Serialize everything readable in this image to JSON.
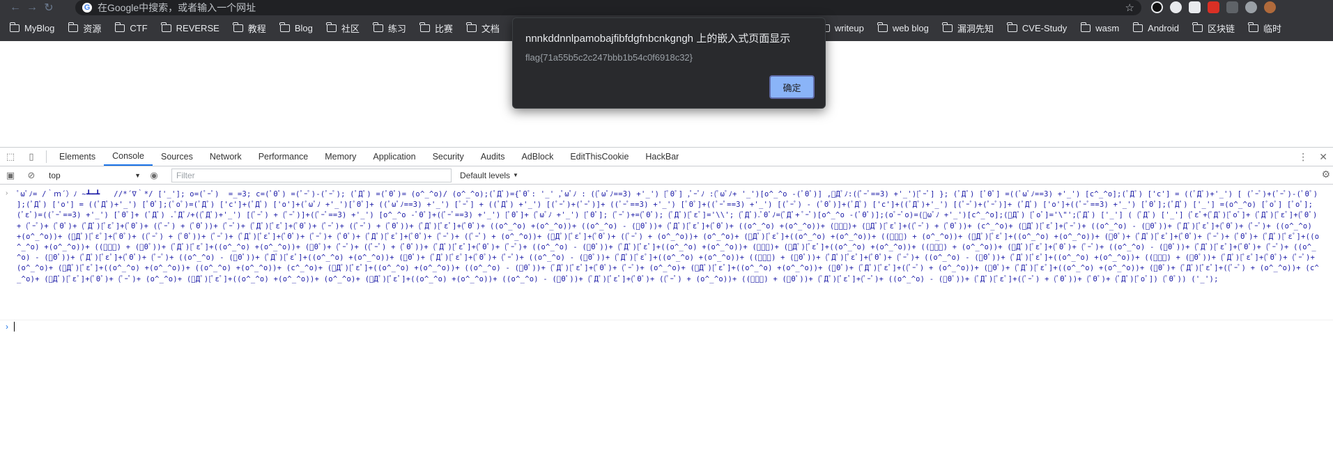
{
  "browser": {
    "omnibox_placeholder": "在Google中搜索，或者输入一个网址",
    "ext_colors": [
      "#111111",
      "#e8eaed",
      "#c5221f",
      "#d93025",
      "#5f6368",
      "#9aa0a6",
      "#b06a3b"
    ]
  },
  "bookmarks": [
    "MyBlog",
    "资源",
    "CTF",
    "REVERSE",
    "教程",
    "Blog",
    "社区",
    "练习",
    "比赛",
    "文档",
    "writeup",
    "web blog",
    "漏洞先知",
    "CVE-Study",
    "wasm",
    "Android",
    "区块链",
    "临时"
  ],
  "dialog": {
    "title": "nnnkddnnlpamobajfibfdgfnbcnkgngh 上的嵌入式页面显示",
    "message": "flag{71a55b5c2c247bbb1b54c0f6918c32}",
    "ok_label": "确定"
  },
  "devtools": {
    "tabs": [
      "Elements",
      "Console",
      "Sources",
      "Network",
      "Performance",
      "Memory",
      "Application",
      "Security",
      "Audits",
      "AdBlock",
      "EditThisCookie",
      "HackBar"
    ],
    "active_tab": "Console",
    "context": "top",
    "filter_placeholder": "Filter",
    "levels_label": "Default levels"
  },
  "console": {
    "entry_text": "ﾟωﾟﾉ= /｀ｍ´）ﾉ ~┻━┻   //*´∇｀*/ ['_']; o=(ﾟｰﾟ)  =_=3; c=(ﾟΘﾟ) =(ﾟｰﾟ)-(ﾟｰﾟ); (ﾟДﾟ) =(ﾟΘﾟ)= (o^_^o)/ (o^_^o);(ﾟДﾟ)={ﾟΘﾟ: '_' ,ﾟωﾟﾉ : ((ﾟωﾟﾉ==3) +'_') [ﾟΘﾟ] ,ﾟｰﾟﾉ :(ﾟωﾟﾉ+ '_')[o^_^o -(ﾟΘﾟ)] ,ﾟДﾟﾉ:((ﾟｰﾟ==3) +'_')[ﾟｰﾟ] }; (ﾟДﾟ) [ﾟΘﾟ] =((ﾟωﾟﾉ==3) +'_') [c^_^o];(ﾟДﾟ) ['c'] = ((ﾟДﾟ)+'_') [ (ﾟｰﾟ)+(ﾟｰﾟ)-(ﾟΘﾟ) ];(ﾟДﾟ) ['o'] = ((ﾟДﾟ)+'_') [ﾟΘﾟ];(ﾟoﾟ)=(ﾟДﾟ) ['c']+(ﾟДﾟ) ['o']+(ﾟωﾟﾉ +'_')[ﾟΘﾟ]+ ((ﾟωﾟﾉ==3) +'_') [ﾟｰﾟ] + ((ﾟДﾟ) +'_') [(ﾟｰﾟ)+(ﾟｰﾟ)]+ ((ﾟｰﾟ==3) +'_') [ﾟΘﾟ]+((ﾟｰﾟ==3) +'_') [(ﾟｰﾟ) - (ﾟΘﾟ)]+(ﾟДﾟ) ['c']+((ﾟДﾟ)+'_') [(ﾟｰﾟ)+(ﾟｰﾟ)]+ (ﾟДﾟ) ['o']+((ﾟｰﾟ==3) +'_') [ﾟΘﾟ];(ﾟДﾟ) ['_'] =(o^_^o) [ﾟoﾟ] [ﾟoﾟ];(ﾟεﾟ)=((ﾟｰﾟ==3) +'_') [ﾟΘﾟ]+ (ﾟДﾟ) .ﾟДﾟﾉ+((ﾟДﾟ)+'_') [(ﾟｰﾟ) + (ﾟｰﾟ)]+((ﾟｰﾟ==3) +'_') [o^_^o -ﾟΘﾟ]+((ﾟｰﾟ==3) +'_') [ﾟΘﾟ]+ (ﾟωﾟﾉ +'_') [ﾟΘﾟ]; (ﾟｰﾟ)+=(ﾟΘﾟ); (ﾟДﾟ)[ﾟεﾟ]='\\\\'; (ﾟДﾟ).ﾟΘﾟﾉ=(ﾟДﾟ+ ﾟｰﾟ)[o^_^o -(ﾟΘﾟ)];(oﾟｰﾟo)=(ﾟωﾟﾉ +'_')[c^_^o];(ﾟДﾟ) [ﾟoﾟ]='\\\"';(ﾟДﾟ) ['_'] ( (ﾟДﾟ) ['_'] (ﾟεﾟ+(ﾟДﾟ)[ﾟoﾟ]+ (ﾟДﾟ)[ﾟεﾟ]+(ﾟΘﾟ)+ (ﾟｰﾟ)+ (ﾟΘﾟ)+ (ﾟДﾟ)[ﾟεﾟ]+(ﾟΘﾟ)+ ((ﾟｰﾟ) + (ﾟΘﾟ))+ (ﾟｰﾟ)+ (ﾟДﾟ)[ﾟεﾟ]+(ﾟΘﾟ)+ (ﾟｰﾟ)+ ((ﾟｰﾟ) + (ﾟΘﾟ))+ (ﾟДﾟ)[ﾟεﾟ]+(ﾟΘﾟ)+ ((o^_^o) +(o^_^o))+ ((o^_^o) - (ﾟΘﾟ))+ (ﾟДﾟ)[ﾟεﾟ]+(ﾟΘﾟ)+ ((o^_^o) +(o^_^o))+ (ﾟｰﾟ)+ (ﾟДﾟ)[ﾟεﾟ]+((ﾟｰﾟ) + (ﾟΘﾟ))+ (c^_^o)+ (ﾟДﾟ)[ﾟεﾟ]+(ﾟｰﾟ)+ ((o^_^o) - (ﾟΘﾟ))+ (ﾟДﾟ)[ﾟεﾟ]+(ﾟΘﾟ)+ (ﾟｰﾟ)+ ((o^_^o) +(o^_^o))+ (ﾟДﾟ)[ﾟεﾟ]+(ﾟΘﾟ)+ ((ﾟｰﾟ) + (ﾟΘﾟ))+ (ﾟｰﾟ)+ (ﾟДﾟ)[ﾟεﾟ]+(ﾟΘﾟ)+ (ﾟｰﾟ)+ (ﾟΘﾟ)+ (ﾟДﾟ)[ﾟεﾟ]+(ﾟΘﾟ)+ (ﾟｰﾟ)+ ((ﾟｰﾟ) + (o^_^o))+ (ﾟДﾟ)[ﾟεﾟ]+(ﾟΘﾟ)+ ((ﾟｰﾟ) + (o^_^o))+ (o^_^o)+ (ﾟДﾟ)[ﾟεﾟ]+((o^_^o) +(o^_^o))+ ((ﾟｰﾟ) + (o^_^o))+ (ﾟДﾟ)[ﾟεﾟ]+((o^_^o) +(o^_^o))+ (ﾟΘﾟ)+ (ﾟДﾟ)[ﾟεﾟ]+(ﾟΘﾟ)+ (ﾟｰﾟ)+ (ﾟΘﾟ)+ (ﾟДﾟ)[ﾟεﾟ]+((o^_^o) +(o^_^o))+ ((ﾟｰﾟ) + (ﾟΘﾟ))+ (ﾟДﾟ)[ﾟεﾟ]+((o^_^o) +(o^_^o))+ (ﾟΘﾟ)+ (ﾟｰﾟ)+ ((ﾟｰﾟ) + (ﾟΘﾟ))+ (ﾟДﾟ)[ﾟεﾟ]+(ﾟΘﾟ)+ (ﾟｰﾟ)+ ((o^_^o) - (ﾟΘﾟ))+ (ﾟДﾟ)[ﾟεﾟ]+((o^_^o) +(o^_^o))+ (ﾟｰﾟ)+ (ﾟДﾟ)[ﾟεﾟ]+((o^_^o) +(o^_^o))+ ((ﾟｰﾟ) + (o^_^o))+ (ﾟДﾟ)[ﾟεﾟ]+(ﾟΘﾟ)+ (ﾟｰﾟ)+ ((o^_^o) - (ﾟΘﾟ))+ (ﾟДﾟ)[ﾟεﾟ]+(ﾟΘﾟ)+ (ﾟｰﾟ)+ ((o^_^o) - (ﾟΘﾟ))+ (ﾟДﾟ)[ﾟεﾟ]+(ﾟΘﾟ)+ (ﾟｰﾟ)+ ((o^_^o) - (ﾟΘﾟ))+ (ﾟДﾟ)[ﾟεﾟ]+((o^_^o) +(o^_^o))+ (ﾟΘﾟ)+ (ﾟДﾟ)[ﾟεﾟ]+(ﾟΘﾟ)+ (ﾟｰﾟ)+ ((o^_^o) - (ﾟΘﾟ))+ (ﾟДﾟ)[ﾟεﾟ]+((o^_^o) +(o^_^o))+ ((ﾟｰﾟ) + (ﾟΘﾟ))+ (ﾟДﾟ)[ﾟεﾟ]+(ﾟΘﾟ)+ (ﾟｰﾟ)+ ((o^_^o) - (ﾟΘﾟ))+ (ﾟДﾟ)[ﾟεﾟ]+((o^_^o) +(o^_^o))+ ((ﾟｰﾟ) + (ﾟΘﾟ))+ (ﾟДﾟ)[ﾟεﾟ]+(ﾟΘﾟ)+ (ﾟｰﾟ)+ (o^_^o)+ (ﾟДﾟ)[ﾟεﾟ]+((o^_^o) +(o^_^o))+ ((o^_^o) +(o^_^o))+ (c^_^o)+ (ﾟДﾟ)[ﾟεﾟ]+((o^_^o) +(o^_^o))+ ((o^_^o) - (ﾟΘﾟ))+ (ﾟДﾟ)[ﾟεﾟ]+(ﾟΘﾟ)+ (ﾟｰﾟ)+ (o^_^o)+ (ﾟДﾟ)[ﾟεﾟ]+((o^_^o) +(o^_^o))+ (ﾟΘﾟ)+ (ﾟДﾟ)[ﾟεﾟ]+((ﾟｰﾟ) + (o^_^o))+ (ﾟΘﾟ)+ (ﾟДﾟ)[ﾟεﾟ]+((o^_^o) +(o^_^o))+ (ﾟΘﾟ)+ (ﾟДﾟ)[ﾟεﾟ]+((ﾟｰﾟ) + (o^_^o))+ (c^_^o)+ (ﾟДﾟ)[ﾟεﾟ]+(ﾟΘﾟ)+ (ﾟｰﾟ)+ (o^_^o)+ (ﾟДﾟ)[ﾟεﾟ]+((o^_^o) +(o^_^o))+ (o^_^o)+ (ﾟДﾟ)[ﾟεﾟ]+((o^_^o) +(o^_^o))+ ((o^_^o) - (ﾟΘﾟ))+ (ﾟДﾟ)[ﾟεﾟ]+(ﾟΘﾟ)+ ((ﾟｰﾟ) + (o^_^o))+ ((ﾟｰﾟ) + (ﾟΘﾟ))+ (ﾟДﾟ)[ﾟεﾟ]+(ﾟｰﾟ)+ ((o^_^o) - (ﾟΘﾟ))+ (ﾟДﾟ)[ﾟεﾟ]+((ﾟｰﾟ) + (ﾟΘﾟ))+ (ﾟΘﾟ)+ (ﾟДﾟ)[ﾟoﾟ]) (ﾟΘﾟ)) ('_');"
  }
}
